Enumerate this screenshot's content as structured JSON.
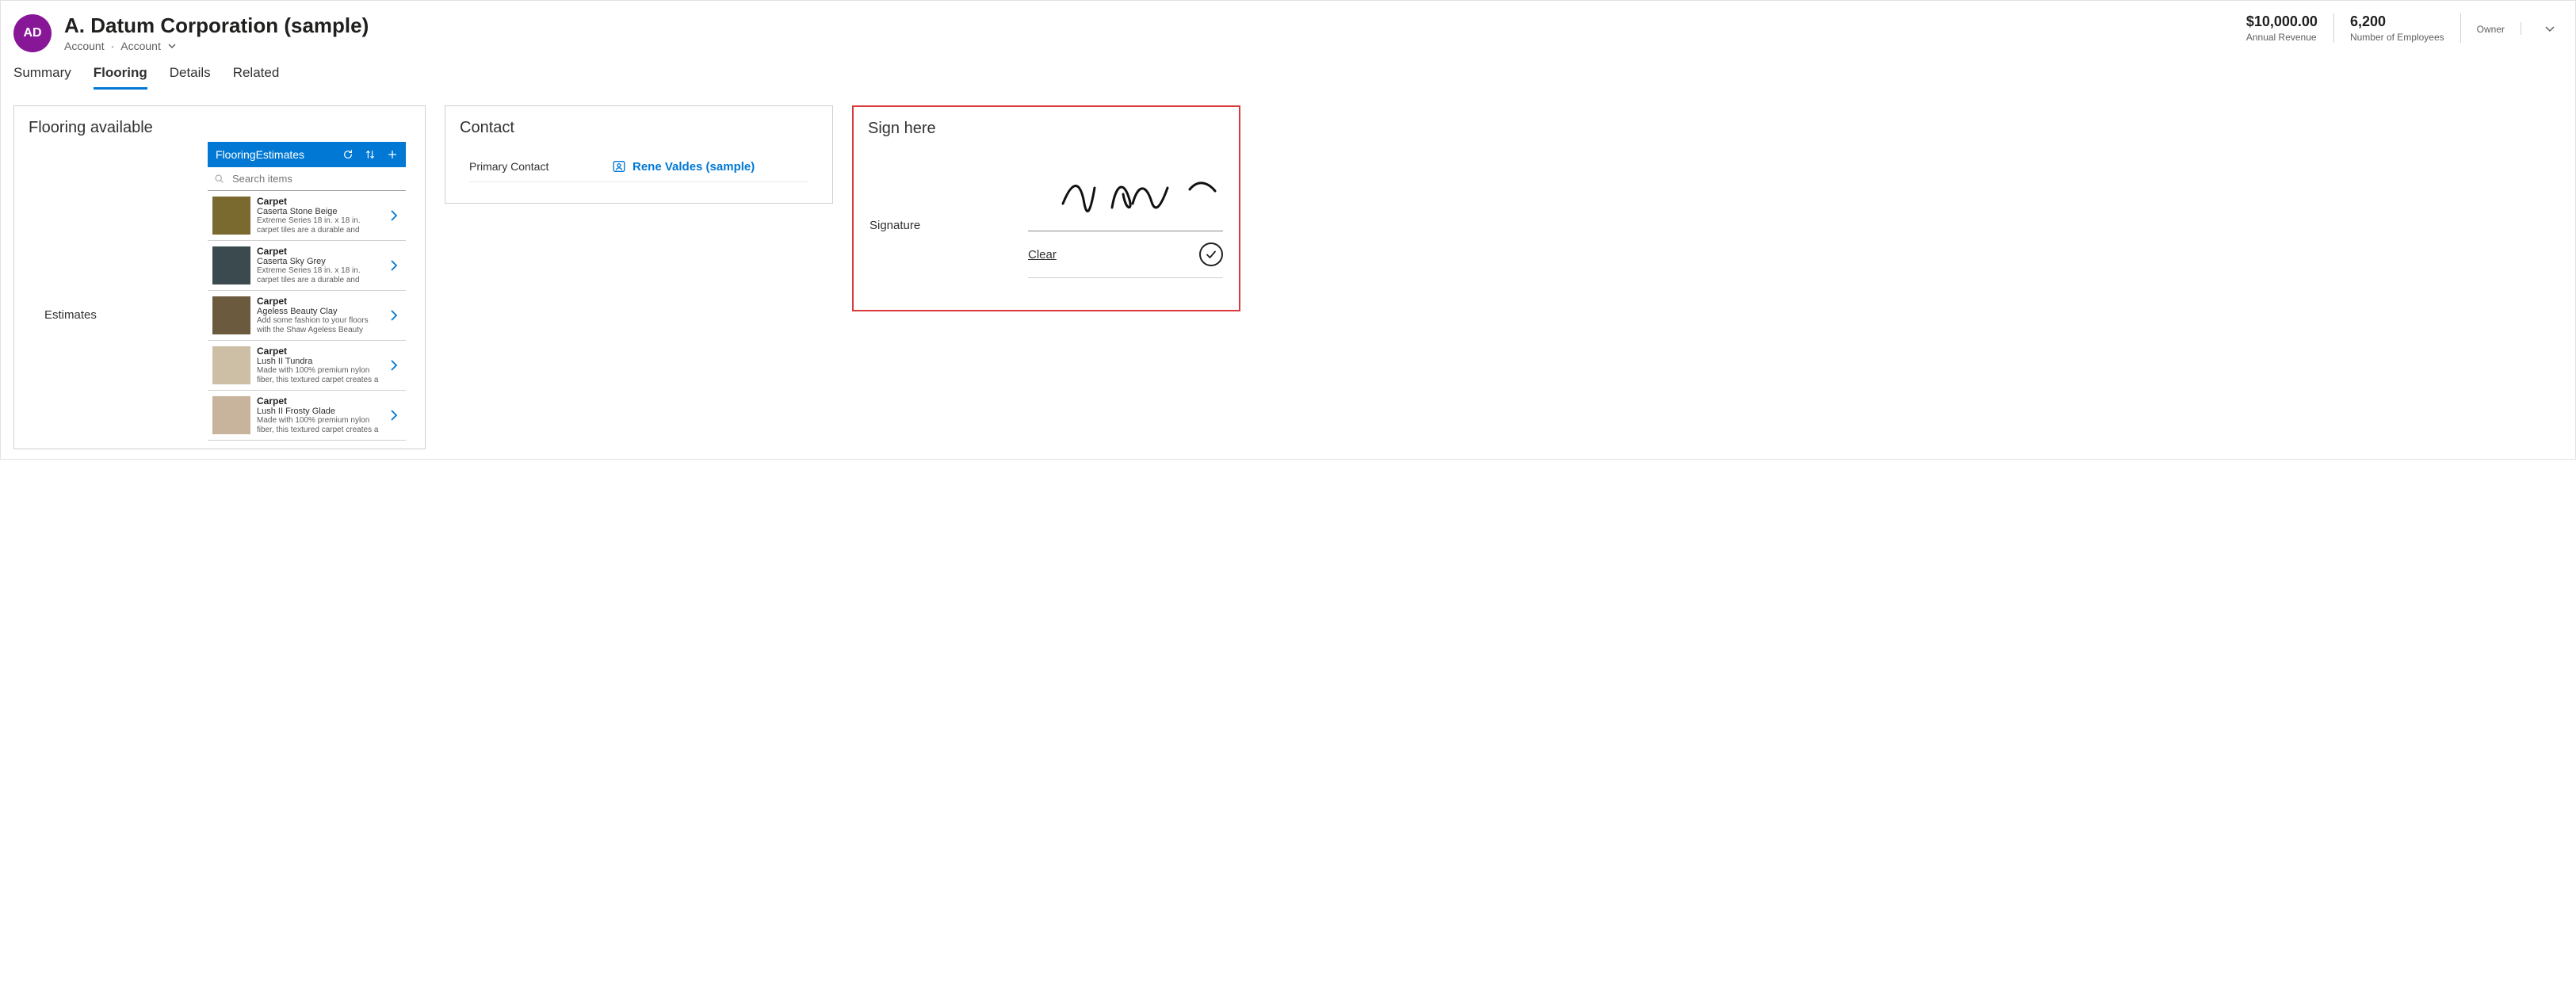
{
  "header": {
    "avatar_initials": "AD",
    "title": "A. Datum Corporation (sample)",
    "entity_type": "Account",
    "form_name": "Account",
    "stats": [
      {
        "value": "$10,000.00",
        "label": "Annual Revenue"
      },
      {
        "value": "6,200",
        "label": "Number of Employees"
      },
      {
        "value": "",
        "label": "Owner"
      }
    ]
  },
  "tabs": [
    "Summary",
    "Flooring",
    "Details",
    "Related"
  ],
  "active_tab": "Flooring",
  "flooring": {
    "card_title": "Flooring available",
    "estimates_label": "Estimates",
    "panel_title": "FlooringEstimates",
    "search_placeholder": "Search items",
    "items": [
      {
        "title": "Carpet",
        "subtitle": "Caserta Stone Beige",
        "description": "Extreme Series 18 in. x 18 in. carpet tiles are a durable and beautiful carpet solution specially engineered for both",
        "color": "#7a6a2f"
      },
      {
        "title": "Carpet",
        "subtitle": "Caserta Sky Grey",
        "description": "Extreme Series 18 in. x 18 in. carpet tiles are a durable and beautiful carpet solution specially engineered for both",
        "color": "#3a4a4f"
      },
      {
        "title": "Carpet",
        "subtitle": "Ageless Beauty Clay",
        "description": "Add some fashion to your floors with the Shaw Ageless Beauty Carpet collection.",
        "color": "#6b5a3e"
      },
      {
        "title": "Carpet",
        "subtitle": "Lush II Tundra",
        "description": "Made with 100% premium nylon fiber, this textured carpet creates a warm, casual atmosphere that invites you to",
        "color": "#cdbfa6"
      },
      {
        "title": "Carpet",
        "subtitle": "Lush II Frosty Glade",
        "description": "Made with 100% premium nylon fiber, this textured carpet creates a warm, casual atmosphere that invites you to",
        "color": "#c8b39d"
      }
    ]
  },
  "contact": {
    "card_title": "Contact",
    "primary_contact_label": "Primary Contact",
    "primary_contact_value": "Rene Valdes (sample)"
  },
  "signature": {
    "card_title": "Sign here",
    "field_label": "Signature",
    "clear_label": "Clear"
  }
}
